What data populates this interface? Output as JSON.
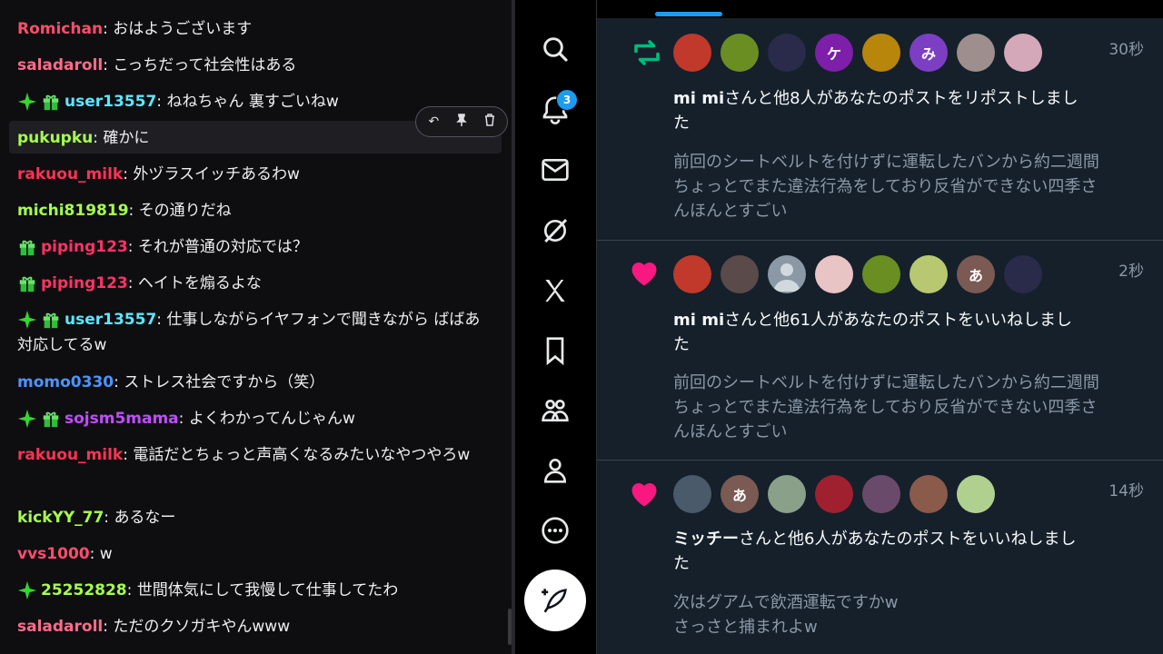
{
  "chat": {
    "messages": [
      {
        "user": "Romichan",
        "text": "おはようございます",
        "color": "#ff4d6d",
        "badges": []
      },
      {
        "user": "saladaroll",
        "text": "こっちだって社会性はある",
        "color": "#ff6b8b",
        "badges": []
      },
      {
        "user": "user13557",
        "text": "ねねちゃん 裏すごいねw",
        "color": "#5ce6ff",
        "badges": [
          "sparkle-icon",
          "gift-icon"
        ]
      },
      {
        "user": "pukupku",
        "text": "確かに",
        "color": "#a6ff4d",
        "badges": []
      },
      {
        "user": "rakuou_milk",
        "text": "外ヅラスイッチあるわw",
        "color": "#ff3355",
        "badges": []
      },
      {
        "user": "michi819819",
        "text": "その通りだね",
        "color": "#a6ff4d",
        "badges": []
      },
      {
        "user": "piping123",
        "text": "それが普通の対応では？",
        "color": "#ff3366",
        "badges": [
          "gift-icon"
        ]
      },
      {
        "user": "piping123",
        "text": "ヘイトを煽るよな",
        "color": "#ff3366",
        "badges": [
          "gift-icon"
        ]
      },
      {
        "user": "user13557",
        "text": "仕事しながらイヤフォンで聞きながら ばばあ対応してるw",
        "color": "#5ce6ff",
        "badges": [
          "sparkle-icon",
          "gift-icon"
        ]
      },
      {
        "user": "momo0330",
        "text": "ストレス社会ですから（笑）",
        "color": "#4d94ff",
        "badges": []
      },
      {
        "user": "sojsm5mama",
        "text": "よくわかってんじゃんw",
        "color": "#c04dff",
        "badges": [
          "sparkle-icon",
          "gift-icon"
        ]
      },
      {
        "user": "rakuou_milk",
        "text": "電話だとちょっと声高くなるみたいなやつやろw",
        "color": "#ff3355",
        "badges": []
      },
      {
        "user": "kickYY_77",
        "text": "あるなー",
        "color": "#a6ff4d",
        "badges": []
      },
      {
        "user": "vvs1000",
        "text": "w",
        "color": "#ff4d6d",
        "badges": []
      },
      {
        "user": "25252828",
        "text": "世間体気にして我慢して仕事してたわ",
        "color": "#a6ff4d",
        "badges": [
          "sparkle-icon"
        ]
      },
      {
        "user": "saladaroll",
        "text": "ただのクソガキやんwww",
        "color": "#ff6b8b",
        "badges": []
      }
    ],
    "toolbar": [
      "reply-icon",
      "pin-icon",
      "delete-icon"
    ]
  },
  "rail": {
    "notification_count": "3",
    "items": [
      "home-icon",
      "search-icon",
      "notifications-icon",
      "messages-icon",
      "grok-icon",
      "x-premium-icon",
      "bookmarks-icon",
      "communities-icon",
      "profile-icon",
      "more-icon"
    ]
  },
  "notifications": [
    {
      "type": "repost",
      "time": "30秒",
      "title_name": "mi mi",
      "title_rest": "さんと他8人があなたのポストをリポストしました",
      "body": "前回のシートベルトを付けずに運転したバンから約二週間ちょっとでまた違法行為をしており反省ができない四季さんほんとすごい",
      "avatars": [
        {
          "bg": "#c0392b",
          "label": ""
        },
        {
          "bg": "#6b8e23",
          "label": ""
        },
        {
          "bg": "#2a2a4a",
          "label": ""
        },
        {
          "bg": "#7d1fa8",
          "label": "ケ"
        },
        {
          "bg": "#b8860b",
          "label": ""
        },
        {
          "bg": "#7c3fc4",
          "label": "み"
        },
        {
          "bg": "#9e8e8e",
          "label": ""
        },
        {
          "bg": "#d4a8b8",
          "label": ""
        }
      ]
    },
    {
      "type": "like",
      "time": "2秒",
      "title_name": "mi mi",
      "title_rest": "さんと他61人があなたのポストをいいねしました",
      "body": "前回のシートベルトを付けずに運転したバンから約二週間ちょっとでまた違法行為をしており反省ができない四季さんほんとすごい",
      "avatars": [
        {
          "bg": "#c0392b",
          "label": ""
        },
        {
          "bg": "#5a4a4a",
          "label": ""
        },
        {
          "bg": "#8b98a5",
          "label": ""
        },
        {
          "bg": "#e8c4c4",
          "label": ""
        },
        {
          "bg": "#6b8e23",
          "label": ""
        },
        {
          "bg": "#b8c870",
          "label": ""
        },
        {
          "bg": "#7a5a52",
          "label": "あ"
        },
        {
          "bg": "#2a2a4a",
          "label": ""
        }
      ]
    },
    {
      "type": "like",
      "time": "14秒",
      "title_name": "ミッチー",
      "title_rest": "さんと他6人があなたのポストをいいねしました",
      "body": "次はグアムで飲酒運転ですかw\nさっさと捕まれよw",
      "avatars": [
        {
          "bg": "#4a5a6a",
          "label": ""
        },
        {
          "bg": "#7a5a52",
          "label": "あ"
        },
        {
          "bg": "#8aa088",
          "label": ""
        },
        {
          "bg": "#a02030",
          "label": ""
        },
        {
          "bg": "#6a4a6a",
          "label": ""
        },
        {
          "bg": "#8a5a4a",
          "label": ""
        },
        {
          "bg": "#b0d090",
          "label": ""
        }
      ]
    }
  ]
}
